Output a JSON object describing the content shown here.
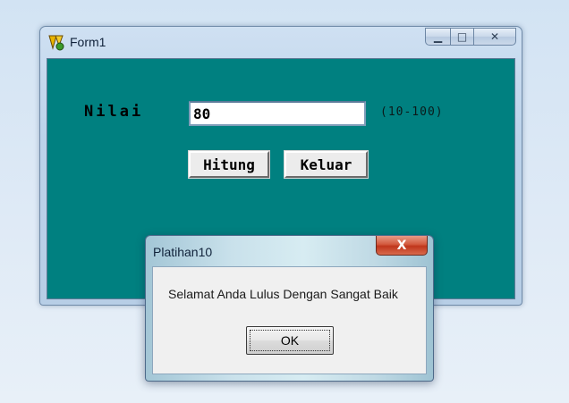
{
  "main_window": {
    "title": "Form1",
    "icon": "delphi-app-icon",
    "minimize_glyph": "▁",
    "maximize_glyph": "□",
    "close_glyph": "✕",
    "client_color": "#008080",
    "nilai_label": "Nilai",
    "nilai_value": "80",
    "range_label": "(10-100)",
    "hitung_label": "Hitung",
    "keluar_label": "Keluar"
  },
  "dialog": {
    "title": "Platihan10",
    "close_glyph": "X",
    "message": "Selamat Anda Lulus Dengan Sangat Baik",
    "ok_label": "OK"
  }
}
